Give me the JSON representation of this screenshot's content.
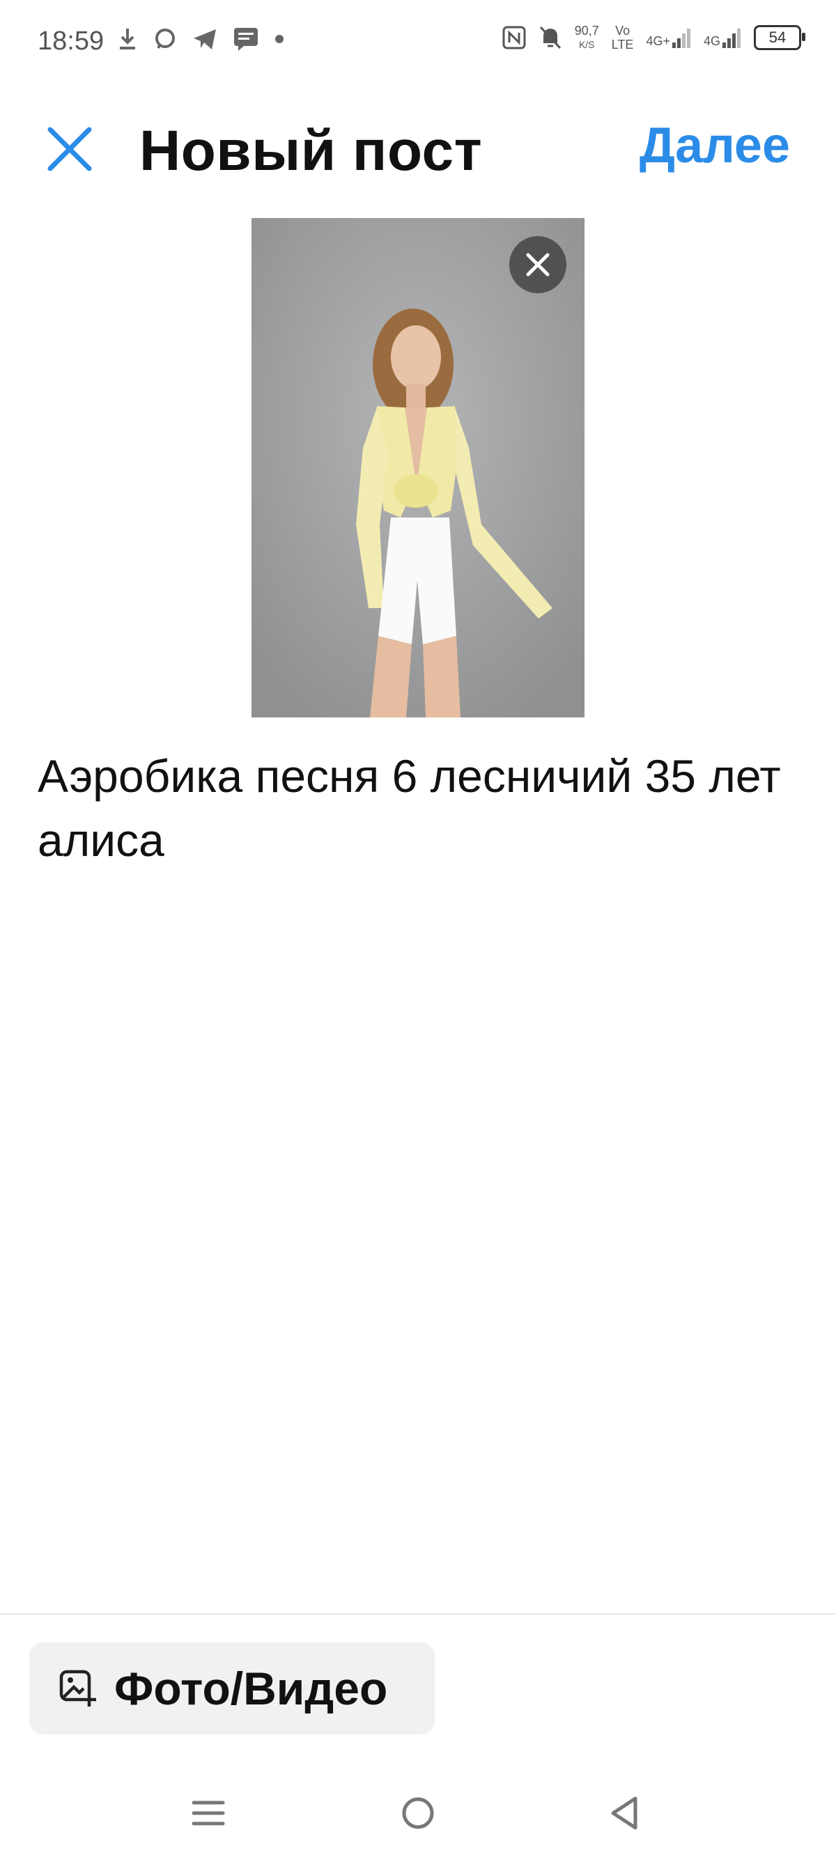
{
  "status_bar": {
    "time": "18:59",
    "net_speed_value": "90,7",
    "net_speed_unit": "K/S",
    "volte_top": "Vo",
    "volte_bottom": "LTE",
    "net1": "4G+",
    "net2": "4G",
    "battery": "54",
    "icons": [
      "download-icon",
      "chat-bubble-icon",
      "telegram-icon",
      "message-icon",
      "dot-icon",
      "nfc-icon",
      "bell-off-icon",
      "signal-icon",
      "signal-icon",
      "battery-icon"
    ]
  },
  "header": {
    "title": "Новый пост",
    "next_label": "Далее"
  },
  "caption": {
    "text": "Аэробика песня 6 лесничий 35 лет алиса"
  },
  "bottom": {
    "add_media_label": "Фото/Видео"
  },
  "colors": {
    "accent": "#2b8ce8",
    "text": "#111111",
    "button_bg": "#f1f1f1"
  }
}
